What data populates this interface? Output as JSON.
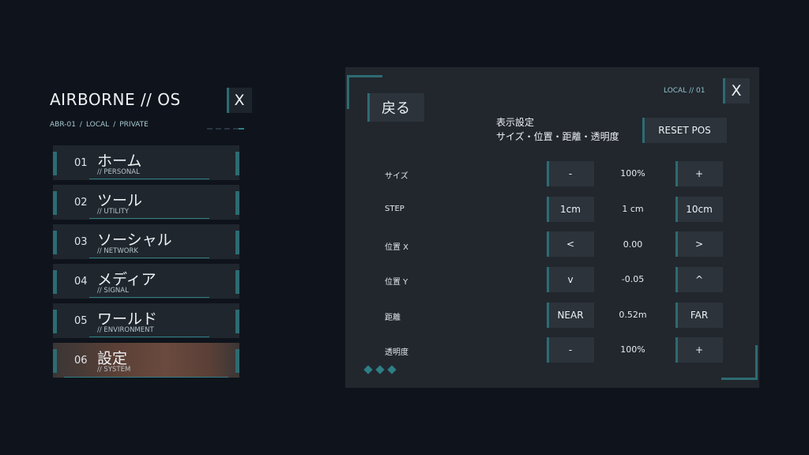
{
  "app": {
    "title": "AIRBORNE // OS",
    "close_label": "X",
    "breadcrumb": [
      "ABR-01",
      "/",
      "LOCAL",
      "/",
      "PRIVATE"
    ]
  },
  "menu": [
    {
      "num": "01",
      "jp": "ホーム",
      "en": "// PERSONAL"
    },
    {
      "num": "02",
      "jp": "ツール",
      "en": "// UTILITY"
    },
    {
      "num": "03",
      "jp": "ソーシャル",
      "en": "// NETWORK"
    },
    {
      "num": "04",
      "jp": "メディア",
      "en": "// SIGNAL"
    },
    {
      "num": "05",
      "jp": "ワールド",
      "en": "// ENVIRONMENT"
    },
    {
      "num": "06",
      "jp": "設定",
      "en": "// SYSTEM"
    }
  ],
  "menu_selected_index": 5,
  "panel": {
    "back_label": "戻る",
    "tag": "LOCAL // 01",
    "close_label": "X",
    "section_title": "表示設定",
    "section_subtitle": "サイズ・位置・距離・透明度",
    "reset_label": "RESET POS",
    "rows": [
      {
        "label": "サイズ",
        "minus": "-",
        "value": "100%",
        "plus": "+"
      },
      {
        "label": "STEP",
        "minus": "1cm",
        "value": "1 cm",
        "plus": "10cm"
      },
      {
        "label": "位置 X",
        "minus": "<",
        "value": "0.00",
        "plus": ">"
      },
      {
        "label": "位置 Y",
        "minus": "v",
        "value": "-0.05",
        "plus": "^"
      },
      {
        "label": "距離",
        "minus": "NEAR",
        "value": "0.52m",
        "plus": "FAR"
      },
      {
        "label": "透明度",
        "minus": "-",
        "value": "100%",
        "plus": "+"
      }
    ]
  },
  "colors": {
    "background": "#0f141c",
    "panel": "#22272e",
    "accent": "#2e6b72",
    "selected": "#6a4a3e"
  }
}
